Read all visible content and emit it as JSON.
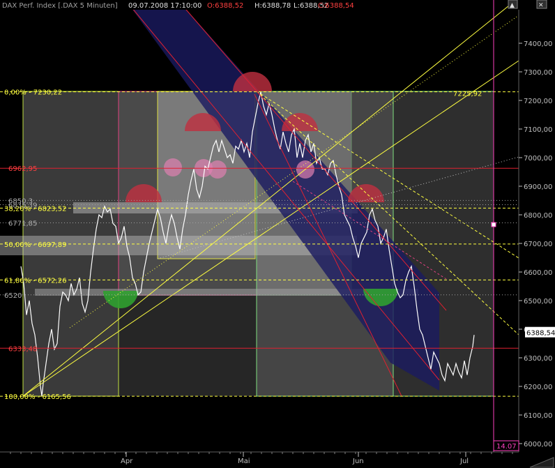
{
  "header": {
    "title": "DAX Perf. Index [.DAX  5 Minuten]",
    "date": "09.07.2008 17:10:00",
    "open": "O:6388,52",
    "high": "H:6388,78",
    "low": "L:6388,52",
    "close": "C:6388,54"
  },
  "window": {
    "scroll_up": "▲",
    "close": "✕"
  },
  "colors": {
    "background": "#000000",
    "price": "#ffffff",
    "fib_line": "#ffff40",
    "red_line": "#e02030",
    "green_fill": "#30a030",
    "red_fill": "#c03040",
    "pink_fill": "#e080b0",
    "blue_channel": "#1a1a60",
    "header_red": "#ff4040",
    "axis_tick": "#c0c0c0",
    "magenta": "#ff40c0"
  },
  "chart_data": {
    "type": "line",
    "title": "DAX Perf. Index [.DAX  5 Minuten]",
    "x_tick_labels": [
      "Apr",
      "Mai",
      "Jun",
      "Jul"
    ],
    "y_tick_labels": [
      "7400,00",
      "7300,00",
      "7200,00",
      "7100,00",
      "7000,00",
      "6900,00",
      "6800,00",
      "6700,00",
      "6600,00",
      "6500,00",
      "6400,00",
      "6300,00",
      "6200,00",
      "6100,00",
      "6000,00"
    ],
    "ylim": [
      5990,
      7490
    ],
    "y_ticks": [
      7400,
      7300,
      7200,
      7100,
      7000,
      6900,
      6800,
      6700,
      6600,
      6500,
      6400,
      6300,
      6200,
      6100,
      6000
    ],
    "last_price_label": "6388,54",
    "last_price": 6388.54,
    "bottom_right_label": "14.07",
    "series": [
      {
        "kind": "price",
        "values_x": [
          0,
          4,
          8,
          12,
          16,
          20,
          24,
          28,
          30,
          32,
          36,
          40,
          44,
          48,
          52,
          56,
          60,
          64,
          68,
          72,
          76,
          80,
          84,
          88,
          92,
          96,
          100,
          104,
          108,
          112,
          116,
          120,
          124,
          128,
          132,
          136,
          140,
          144,
          148,
          152,
          156,
          160,
          164,
          168,
          172,
          176,
          180,
          184,
          188,
          192,
          196,
          200,
          204,
          208,
          212,
          216,
          220,
          224,
          228,
          232,
          236,
          240,
          244,
          248,
          252,
          256,
          260,
          264,
          268,
          272,
          276,
          280,
          284,
          288,
          292,
          296,
          300,
          304,
          308,
          312,
          316,
          320,
          324,
          328,
          332,
          336,
          340,
          344,
          348,
          352,
          356,
          360,
          364,
          368,
          372,
          376,
          380,
          384,
          388,
          392,
          396,
          400,
          404,
          408,
          412,
          416,
          420,
          424,
          428,
          432,
          436,
          440,
          444,
          448,
          452,
          456,
          460,
          464,
          468,
          472,
          476,
          480,
          484,
          488,
          492,
          496,
          500,
          504,
          508,
          512,
          516,
          520,
          524,
          528,
          532,
          536,
          540,
          544,
          548,
          552,
          556,
          560,
          564,
          568,
          572,
          576,
          580,
          584,
          588,
          592,
          596,
          600,
          604,
          608,
          612,
          616,
          620,
          624,
          628,
          632,
          636,
          640,
          644,
          648,
          650
        ],
        "values_y": [
          6620,
          6560,
          6450,
          6500,
          6420,
          6380,
          6300,
          6200,
          6166,
          6210,
          6280,
          6350,
          6400,
          6330,
          6350,
          6480,
          6530,
          6520,
          6500,
          6560,
          6520,
          6540,
          6580,
          6490,
          6460,
          6500,
          6600,
          6680,
          6750,
          6800,
          6790,
          6830,
          6810,
          6820,
          6770,
          6760,
          6700,
          6720,
          6760,
          6690,
          6650,
          6580,
          6560,
          6520,
          6530,
          6600,
          6650,
          6700,
          6740,
          6780,
          6820,
          6790,
          6740,
          6700,
          6760,
          6800,
          6770,
          6720,
          6680,
          6750,
          6800,
          6870,
          6920,
          6960,
          6890,
          6860,
          6900,
          6970,
          6960,
          7000,
          7040,
          7060,
          7020,
          7060,
          7030,
          7000,
          7010,
          6980,
          7040,
          7030,
          7060,
          7020,
          7050,
          7000,
          7090,
          7140,
          7190,
          7230,
          7180,
          7150,
          7190,
          7150,
          7100,
          7060,
          7030,
          7090,
          7050,
          7020,
          7080,
          7100,
          7000,
          7050,
          7000,
          7060,
          7080,
          7020,
          7050,
          6980,
          7000,
          6960,
          6960,
          6940,
          6980,
          6990,
          6940,
          6900,
          6870,
          6800,
          6780,
          6760,
          6720,
          6690,
          6650,
          6700,
          6720,
          6740,
          6800,
          6820,
          6780,
          6760,
          6700,
          6720,
          6750,
          6680,
          6620,
          6560,
          6530,
          6510,
          6520,
          6570,
          6600,
          6620,
          6550,
          6470,
          6400,
          6380,
          6340,
          6300,
          6260,
          6320,
          6300,
          6280,
          6240,
          6220,
          6280,
          6260,
          6240,
          6280,
          6250,
          6230,
          6290,
          6240,
          6300,
          6340,
          6380,
          6388
        ]
      }
    ],
    "fib_labels": [
      {
        "text": "0,00% - 7230,22",
        "y": 7230.22
      },
      {
        "text": "38,20% - 6823,52",
        "y": 6823.52
      },
      {
        "text": "50,00% - 6697,89",
        "y": 6697.89
      },
      {
        "text": "61,80% - 6572,26",
        "y": 6572.26
      },
      {
        "text": "100,00% - 6165,56",
        "y": 6165.56
      }
    ],
    "level_labels": [
      {
        "text": "6962,95",
        "y": 6962.95
      },
      {
        "text": "6850,3",
        "y": 6850.3
      },
      {
        "text": "6835,39",
        "y": 6835.39
      },
      {
        "text": "6771,85",
        "y": 6771.85
      },
      {
        "text": "6333,48",
        "y": 6333.48
      },
      {
        "text": "6520",
        "y": 6520
      },
      {
        "text": "7225,92",
        "y": 7225.92
      }
    ]
  }
}
